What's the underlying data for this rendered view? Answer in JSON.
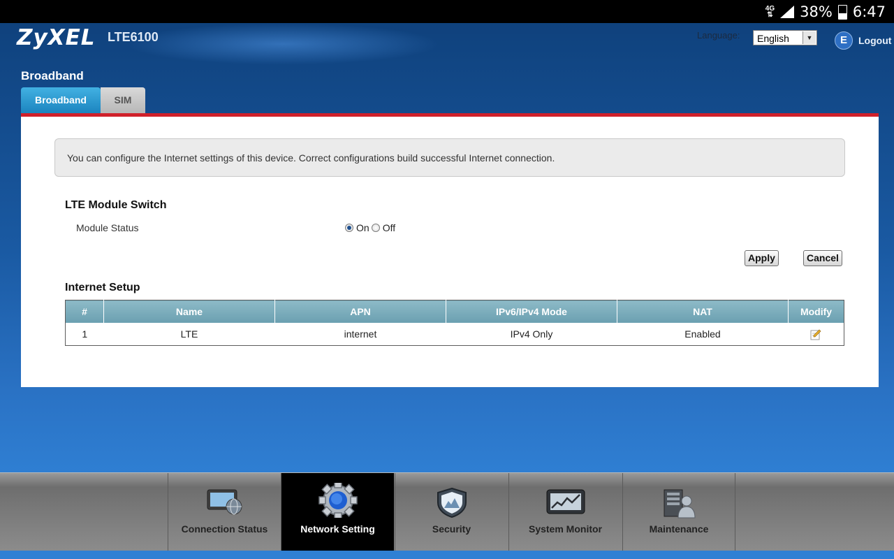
{
  "status_bar": {
    "network": "4G",
    "battery": "38%",
    "battery_level": 0.38,
    "time": "6:47"
  },
  "header": {
    "logo": "ZyXEL",
    "model": "LTE6100",
    "language_label": "Language:",
    "language_value": "English",
    "logout_label": "Logout"
  },
  "page": {
    "title": "Broadband",
    "tabs": [
      {
        "label": "Broadband",
        "active": true
      },
      {
        "label": "SIM",
        "active": false
      }
    ]
  },
  "info": "You can configure the Internet settings of this device. Correct configurations build successful Internet connection.",
  "lte_switch": {
    "title": "LTE Module Switch",
    "module_status_label": "Module Status",
    "options": [
      "On",
      "Off"
    ],
    "selected": "On",
    "apply_label": "Apply",
    "cancel_label": "Cancel"
  },
  "internet_setup": {
    "title": "Internet Setup",
    "columns": [
      "#",
      "Name",
      "APN",
      "IPv6/IPv4 Mode",
      "NAT",
      "Modify"
    ],
    "rows": [
      {
        "index": "1",
        "name": "LTE",
        "apn": "internet",
        "mode": "IPv4 Only",
        "nat": "Enabled",
        "modify_icon": "edit-icon"
      }
    ]
  },
  "bottom_nav": [
    {
      "label": "Connection Status",
      "icon": "monitor-globe-icon",
      "active": false
    },
    {
      "label": "Network Setting",
      "icon": "gear-icon",
      "active": true
    },
    {
      "label": "Security",
      "icon": "shield-icon",
      "active": false
    },
    {
      "label": "System Monitor",
      "icon": "chart-monitor-icon",
      "active": false
    },
    {
      "label": "Maintenance",
      "icon": "maintenance-icon",
      "active": false
    }
  ],
  "colors": {
    "tab_rule": "#d0202a",
    "tab_active": "#1b84bf",
    "table_header": "#7aaebd",
    "page_bg": "#1a5aa3"
  }
}
